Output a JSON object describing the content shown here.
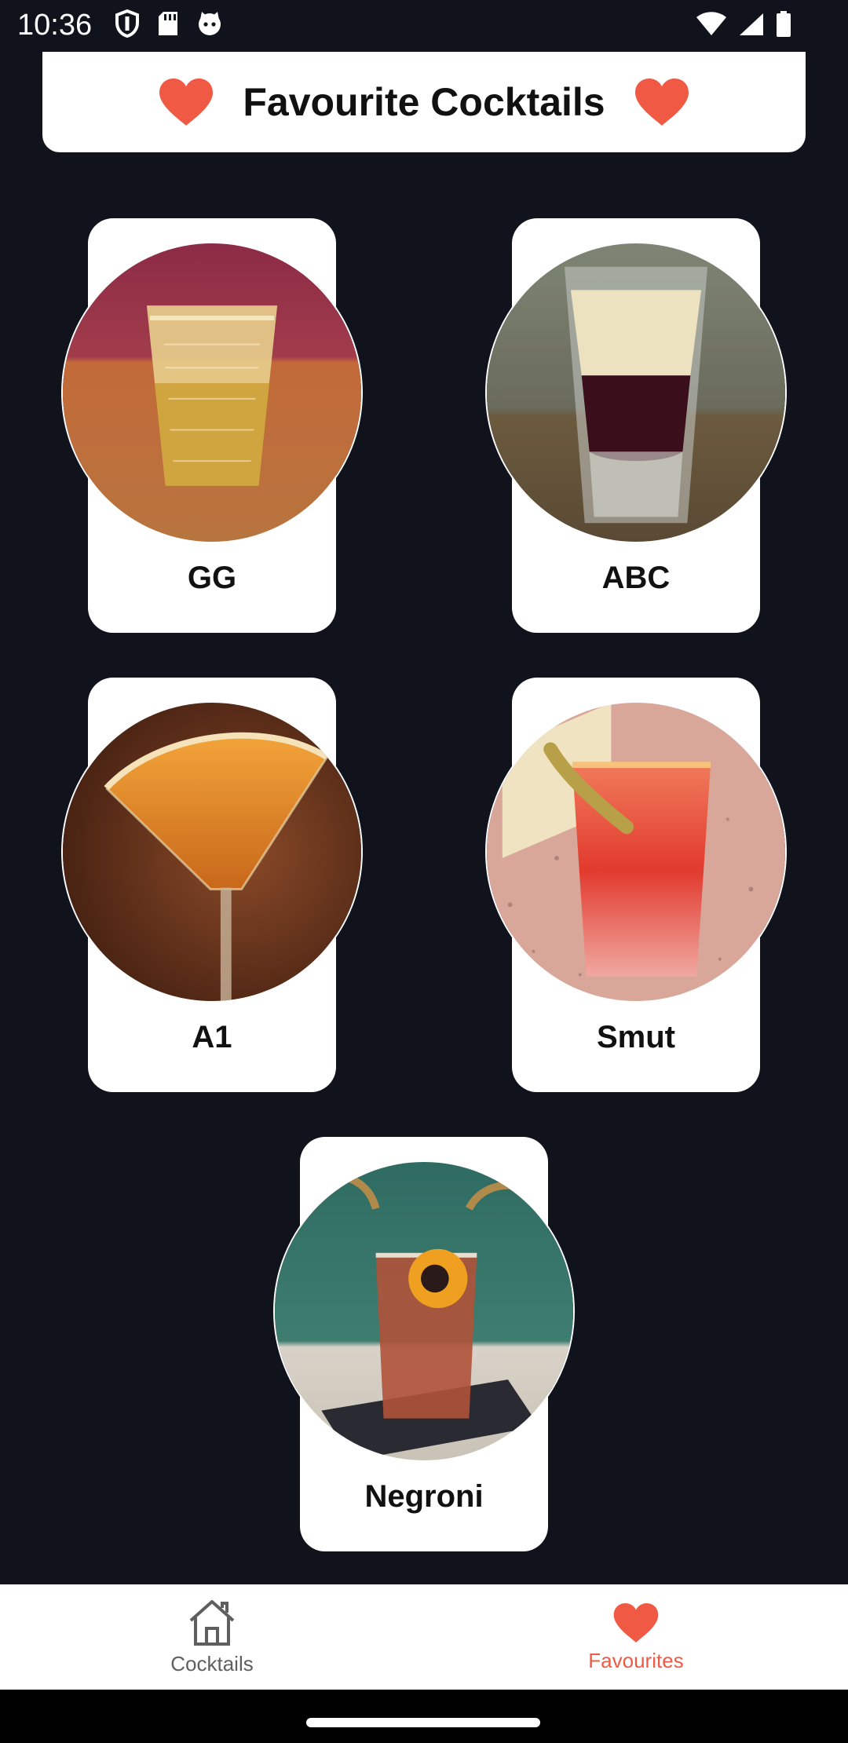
{
  "status_bar": {
    "time": "10:36"
  },
  "header": {
    "title": "Favourite Cocktails",
    "heart_color": "#f05a45"
  },
  "cocktails": [
    {
      "name": "GG"
    },
    {
      "name": "ABC"
    },
    {
      "name": "A1"
    },
    {
      "name": "Smut"
    },
    {
      "name": "Negroni"
    }
  ],
  "bottom_nav": {
    "items": [
      {
        "label": "Cocktails",
        "icon": "home-icon",
        "selected": false
      },
      {
        "label": "Favourites",
        "icon": "heart-icon",
        "selected": true
      }
    ],
    "active_color": "#f05a45",
    "inactive_color": "#5f5f5f"
  }
}
